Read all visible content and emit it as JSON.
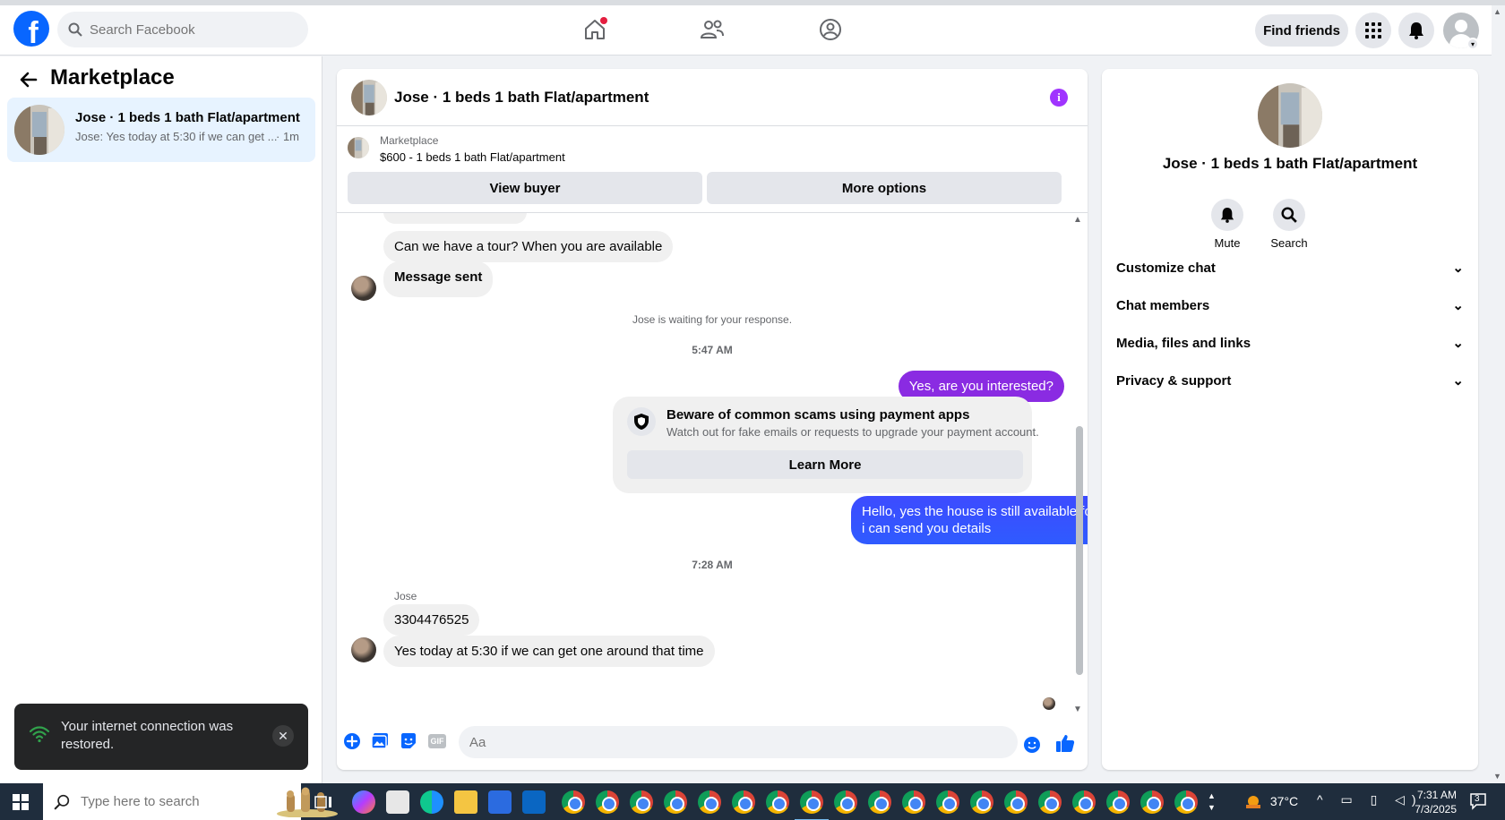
{
  "header": {
    "search_placeholder": "Search Facebook",
    "find_friends": "Find friends",
    "logo_letter": "f"
  },
  "left": {
    "title": "Marketplace",
    "conversation": {
      "name": "Jose · 1 beds 1 bath Flat/apartment",
      "preview": "Jose: Yes today at 5:30 if we can get ...",
      "time": "· 1m"
    }
  },
  "toast": {
    "message": "Your internet connection was restored.",
    "close": "✕"
  },
  "chat": {
    "title": "Jose · 1 beds 1 bath Flat/apartment",
    "info": "i",
    "listing_label": "Marketplace",
    "listing_price": "$600 - 1 beds 1 bath Flat/apartment",
    "view_buyer": "View buyer",
    "more_options": "More options",
    "messages": {
      "tour": "Can we have a tour? When you are available",
      "sent": "Message sent",
      "waiting": "Jose is waiting for your response.",
      "time1": "5:47 AM",
      "interested": "Yes, are you interested?",
      "scam_title": "Beware of common scams using payment apps",
      "scam_sub": "Watch out for fake emails or requests to upgrade your payment account.",
      "learn_more": "Learn More",
      "reply": "Hello, yes the house is still available for rent, let me have your contact number so i can send you details",
      "time2": "7:28 AM",
      "sender": "Jose",
      "phone": "3304476525",
      "last": "Yes today at 5:30 if we can get one around that time"
    },
    "composer_placeholder": "Aa",
    "gif_label": "GIF"
  },
  "right": {
    "title": "Jose · 1 beds 1 bath Flat/apartment",
    "mute": "Mute",
    "search": "Search",
    "rows": [
      "Customize chat",
      "Chat members",
      "Media, files and links",
      "Privacy & support"
    ]
  },
  "taskbar": {
    "search_placeholder": "Type here to search",
    "temperature": "37°C",
    "time": "7:31 AM",
    "date": "7/3/2025",
    "notif_count": "3"
  },
  "colors": {
    "brand": "#0866ff",
    "message_gradient_top": "#8a2be2",
    "message_gradient_bottom": "#2f5bff",
    "taskbar": "#1f2d3d"
  }
}
